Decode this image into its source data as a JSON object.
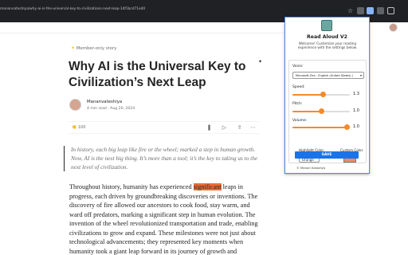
{
  "browser": {
    "url": "mananvateshiya/why-ai-is-the-universal-key-to-civilizations-next-leap-14f1bcd71ed0",
    "icons": [
      "bookmark-star-icon",
      "extension-icon",
      "read-aloud-icon",
      "puzzle-icon",
      "sidepanel-icon"
    ]
  },
  "article": {
    "member_label": "Member-only story",
    "title": "Why AI is the Universal Key to Civilization’s Next Leap",
    "author": "Mananvateshiya",
    "meta": "4 min read · Aug 20, 2024",
    "claps": "100",
    "quote": "In history, each big leap like fire or the wheel; marked a step in human growth. Now, AI is the next big thing. It’s more than a tool; it’s the key to taking us to the next level of civilization.",
    "body_before": "Throughout history, humanity has experienced ",
    "body_highlight": "significant",
    "body_after": " leaps in progress, each driven by groundbreaking discoveries or inventions. The discovery of fire allowed our ancestors to cook food, stay warm, and ward off predators, marking a significant step in human evolution. The invention of the wheel revolutionized transportation and trade, enabling civilizations to grow and expand. These milestones were not just about technological advancements; they represented key moments when humanity took a giant leap forward in its journey of growth and development. Today, we stand on the brink of"
  },
  "popup": {
    "title": "Read Aloud V2",
    "subtitle": "Welcome! Customize your reading experience with the settings below.",
    "voice_label": "Voice:",
    "voice_value": "Microsoft Zira - English (United States) (",
    "speed_label": "Speed:",
    "speed_value": "1.3",
    "speed_level": 0.53,
    "pitch_label": "Pitch:",
    "pitch_value": "1.0",
    "pitch_level": 0.5,
    "volume_label": "Volume:",
    "volume_value": "1.0",
    "volume_level": 1.0,
    "highlight_color_label": "Highlight Color",
    "highlight_color_value": "Orange",
    "custom_color_label": "Custom Color",
    "custom_color": "#f28b66",
    "save_label": "SAVE",
    "footer": "© Manan Kakadiya",
    "accent": "#f28b2c",
    "save_color": "#1a73e8"
  }
}
